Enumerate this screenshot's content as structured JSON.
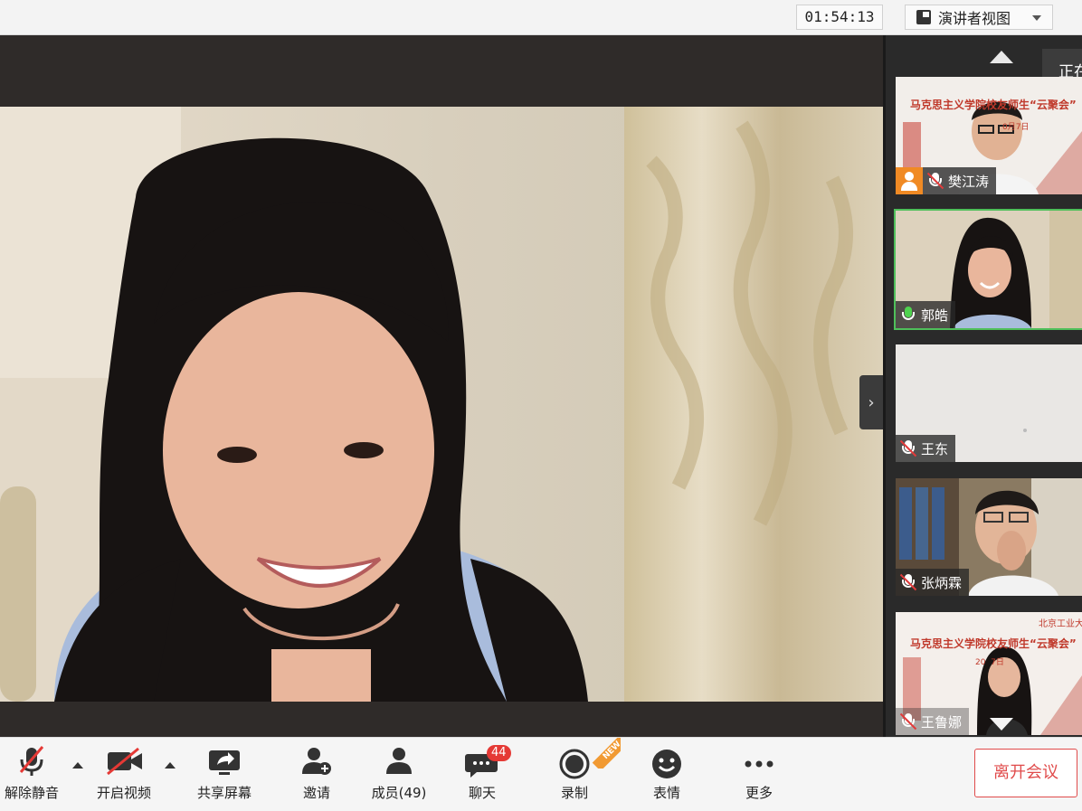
{
  "topbar": {
    "timer": "01:54:13",
    "view_mode": "演讲者视图",
    "view_icon": "presenter-view-icon"
  },
  "side_panel": {
    "speaking_tip": "正在",
    "tiles": [
      {
        "name": "樊江涛",
        "mic": "muted",
        "has_avatar_badge": true,
        "banner": "马克思主义学院校友师生“云聚会”",
        "banner_sub": "0月7日"
      },
      {
        "name": "郭皓",
        "mic": "speaking",
        "active": true
      },
      {
        "name": "王东",
        "mic": "muted"
      },
      {
        "name": "张炳霖",
        "mic": "muted"
      },
      {
        "name": "王鲁娜",
        "mic": "muted",
        "banner": "马克思主义学院校友师生“云聚会”",
        "banner_sub": "20  7日",
        "seal": "北京工业大学"
      }
    ]
  },
  "toolbar": {
    "items": [
      {
        "label": "解除静音",
        "icon": "microphone-muted-icon"
      },
      {
        "label": "开启视频",
        "icon": "camera-off-icon"
      },
      {
        "label": "共享屏幕",
        "icon": "share-screen-icon"
      },
      {
        "label": "邀请",
        "icon": "invite-user-icon"
      },
      {
        "label": "成员(49)",
        "icon": "members-icon"
      },
      {
        "label": "聊天",
        "icon": "chat-icon",
        "badge": "44"
      },
      {
        "label": "录制",
        "icon": "record-icon",
        "ribbon": "NEW"
      },
      {
        "label": "表情",
        "icon": "emoji-icon"
      },
      {
        "label": "更多",
        "icon": "more-icon"
      }
    ],
    "leave_label": "离开会议"
  },
  "colors": {
    "accent_green": "#4fbf5a",
    "danger_red": "#e04b4b",
    "badge_red": "#e53935",
    "new_orange": "#f19a33"
  }
}
